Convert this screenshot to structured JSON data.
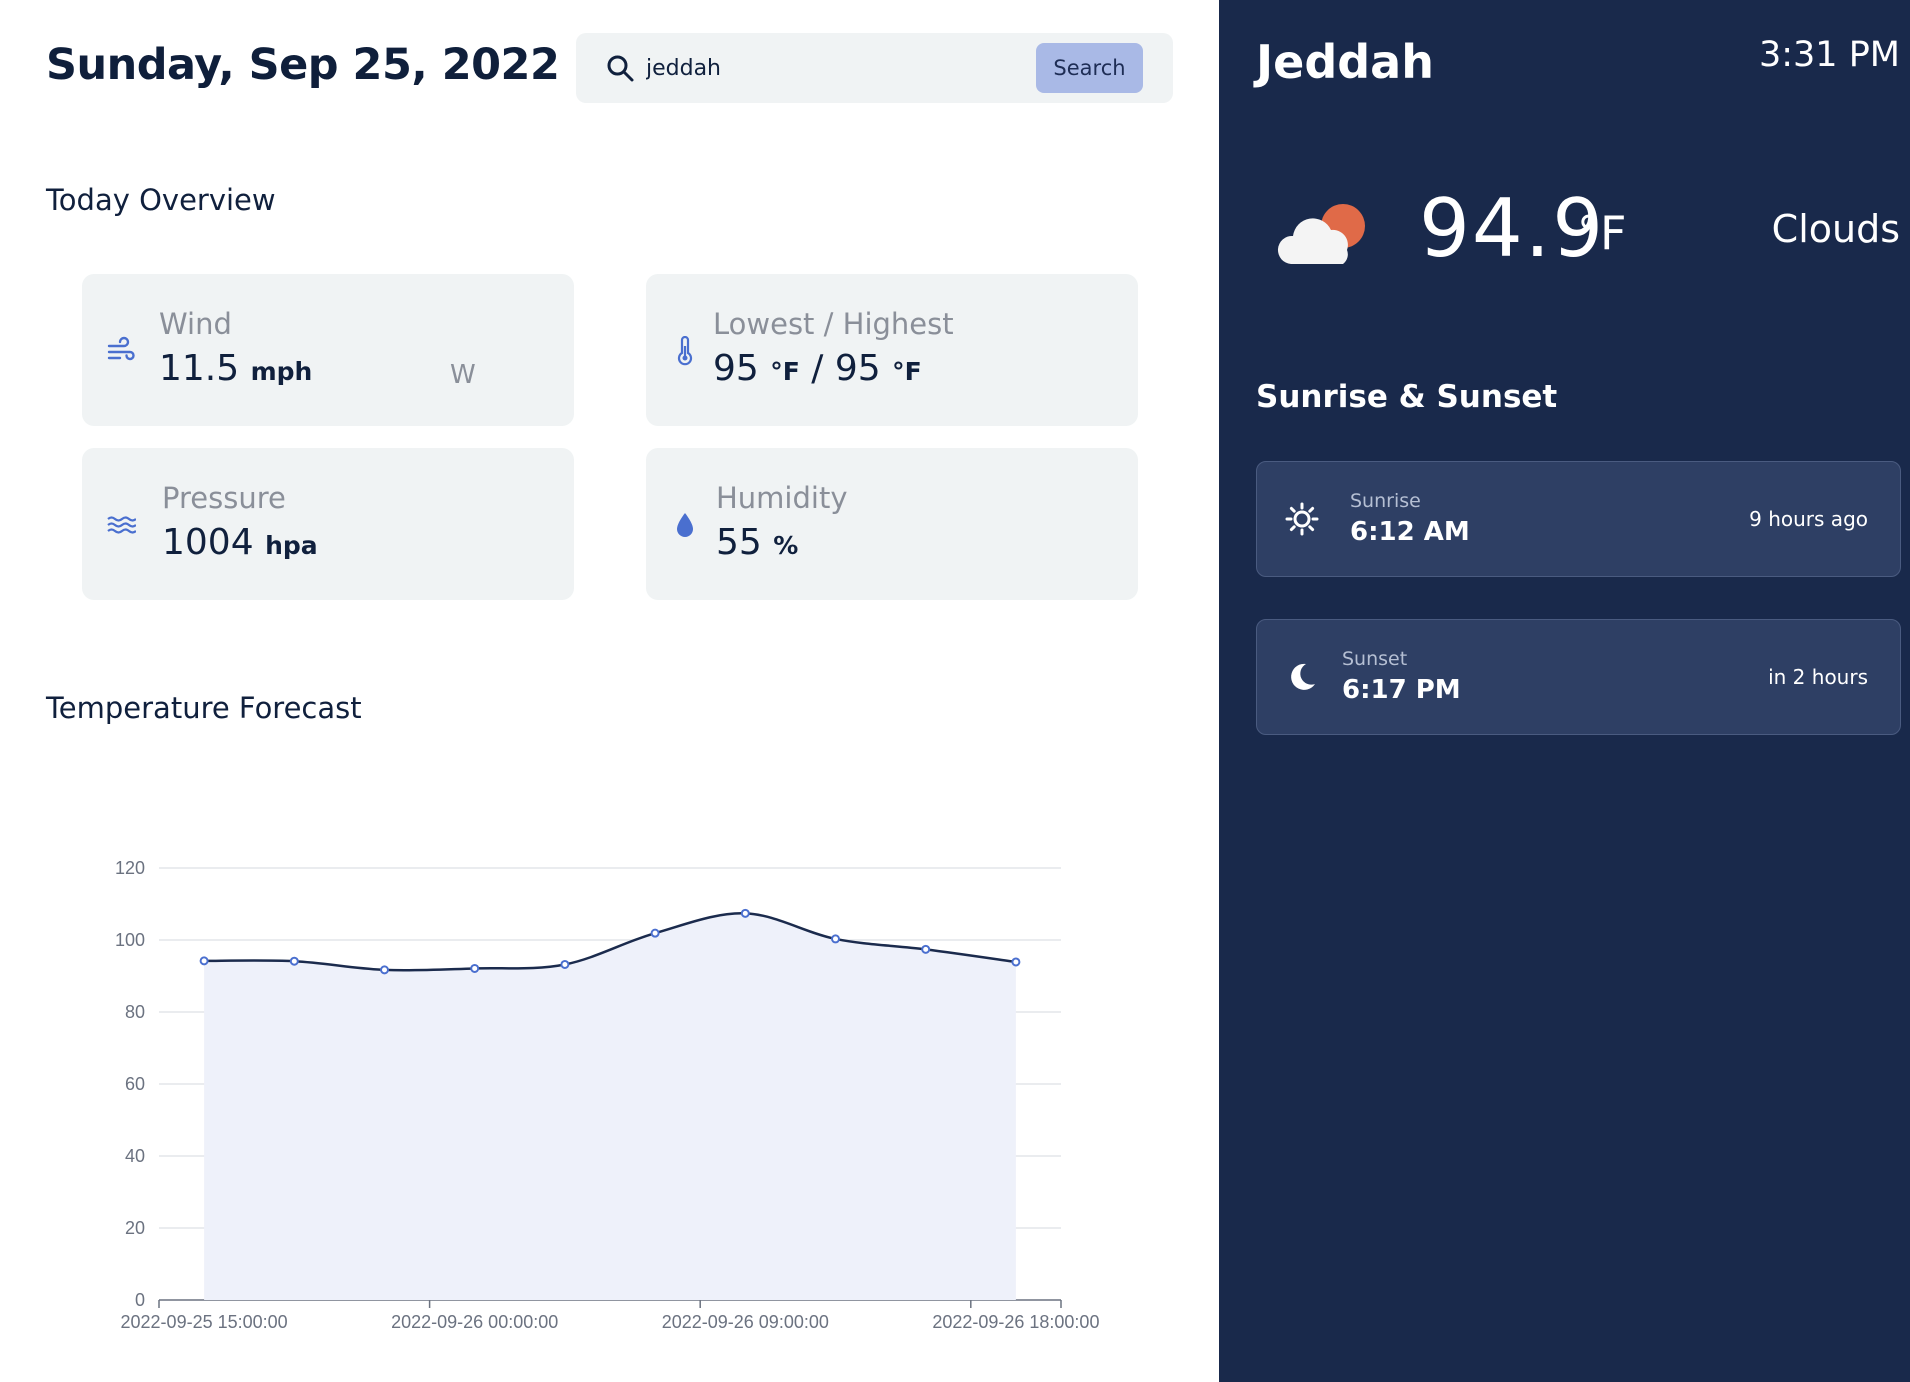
{
  "header": {
    "date": "Sunday, Sep 25, 2022"
  },
  "search": {
    "value": "jeddah",
    "button_label": "Search",
    "icon": "search-icon"
  },
  "overview": {
    "title": "Today Overview",
    "wind": {
      "label": "Wind",
      "value": "11.5",
      "unit": "mph",
      "direction": "W",
      "icon": "wind-icon"
    },
    "temp_range": {
      "label": "Lowest / Highest",
      "low": "95",
      "high": "95",
      "unit": "°F",
      "separator": "/",
      "icon": "thermometer-icon"
    },
    "pressure": {
      "label": "Pressure",
      "value": "1004",
      "unit": "hpa",
      "icon": "waves-icon"
    },
    "humidity": {
      "label": "Humidity",
      "value": "55",
      "unit": "%",
      "icon": "droplet-icon"
    }
  },
  "forecast": {
    "title": "Temperature Forecast"
  },
  "chart_data": {
    "type": "area",
    "x": [
      "2022-09-25 15:00:00",
      "2022-09-25 18:00:00",
      "2022-09-25 21:00:00",
      "2022-09-26 00:00:00",
      "2022-09-26 03:00:00",
      "2022-09-26 06:00:00",
      "2022-09-26 09:00:00",
      "2022-09-26 12:00:00",
      "2022-09-26 15:00:00",
      "2022-09-26 18:00:00"
    ],
    "values": [
      94.2,
      94.1,
      91.7,
      92.1,
      93.2,
      101.9,
      107.4,
      100.3,
      97.4,
      93.9
    ],
    "xticks": [
      "2022-09-25 15:00:00",
      "2022-09-26 00:00:00",
      "2022-09-26 09:00:00",
      "2022-09-26 18:00:00"
    ],
    "yticks": [
      "0",
      "20",
      "40",
      "60",
      "80",
      "100",
      "120"
    ],
    "ylim": [
      0,
      120
    ],
    "grid": true,
    "line_color": "#1b2b4d",
    "fill_color": "#eef1fa",
    "point_color": "#4a6fcf"
  },
  "sidebar": {
    "city": "Jeddah",
    "time": "3:31 PM",
    "temperature": "94.9",
    "temperature_unit": "°F",
    "condition": "Clouds",
    "condition_icon": "cloud-sun-icon",
    "sun_title": "Sunrise & Sunset",
    "sunrise": {
      "label": "Sunrise",
      "time": "6:12 AM",
      "relative": "9 hours ago",
      "icon": "sun-icon"
    },
    "sunset": {
      "label": "Sunset",
      "time": "6:17 PM",
      "relative": "in 2 hours",
      "icon": "moon-icon"
    }
  },
  "colors": {
    "sidebar_bg": "#19294b",
    "card_bg": "#f0f3f4",
    "accent": "#4a6fcf",
    "button_bg": "#a9b9e6"
  }
}
